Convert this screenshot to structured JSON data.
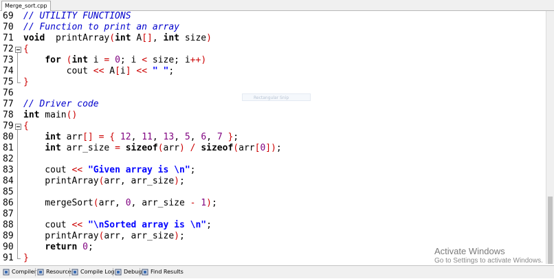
{
  "tab": {
    "filename": "Merge_sort.cpp"
  },
  "code": {
    "lines": [
      {
        "n": "69",
        "parts": [
          [
            "cm",
            "// UTILITY FUNCTIONS"
          ]
        ]
      },
      {
        "n": "70",
        "parts": [
          [
            "cm",
            "// Function to print an array"
          ]
        ]
      },
      {
        "n": "71",
        "parts": [
          [
            "kw",
            "void"
          ],
          [
            "",
            "  printArray"
          ],
          [
            "br",
            "("
          ],
          [
            "kw",
            "int"
          ],
          [
            "",
            " A"
          ],
          [
            "br",
            "[]"
          ],
          [
            "",
            ", "
          ],
          [
            "kw",
            "int"
          ],
          [
            "",
            " size"
          ],
          [
            "br",
            ")"
          ]
        ]
      },
      {
        "n": "72",
        "fold": true,
        "parts": [
          [
            "br",
            "{"
          ]
        ]
      },
      {
        "n": "73",
        "parts": [
          [
            "",
            "    "
          ],
          [
            "kw",
            "for"
          ],
          [
            "",
            " "
          ],
          [
            "br",
            "("
          ],
          [
            "kw",
            "int"
          ],
          [
            "",
            " i "
          ],
          [
            "op",
            "="
          ],
          [
            "",
            " "
          ],
          [
            "num",
            "0"
          ],
          [
            "",
            "; i "
          ],
          [
            "op",
            "<"
          ],
          [
            "",
            " size; i"
          ],
          [
            "op",
            "++"
          ],
          [
            "br",
            ")"
          ]
        ]
      },
      {
        "n": "74",
        "parts": [
          [
            "",
            "        cout "
          ],
          [
            "op",
            "<<"
          ],
          [
            "",
            " A"
          ],
          [
            "br",
            "["
          ],
          [
            "",
            "i"
          ],
          [
            "br",
            "]"
          ],
          [
            "",
            " "
          ],
          [
            "op",
            "<<"
          ],
          [
            "",
            " "
          ],
          [
            "str",
            "\" \""
          ],
          [
            "",
            ";"
          ]
        ]
      },
      {
        "n": "75",
        "foldEnd": true,
        "parts": [
          [
            "br",
            "}"
          ]
        ]
      },
      {
        "n": "76",
        "parts": []
      },
      {
        "n": "77",
        "parts": [
          [
            "cm",
            "// Driver code"
          ]
        ]
      },
      {
        "n": "78",
        "parts": [
          [
            "kw",
            "int"
          ],
          [
            "",
            " main"
          ],
          [
            "br",
            "()"
          ]
        ]
      },
      {
        "n": "79",
        "fold": true,
        "parts": [
          [
            "br",
            "{"
          ]
        ]
      },
      {
        "n": "80",
        "parts": [
          [
            "",
            "    "
          ],
          [
            "kw",
            "int"
          ],
          [
            "",
            " arr"
          ],
          [
            "br",
            "[]"
          ],
          [
            "",
            " "
          ],
          [
            "op",
            "="
          ],
          [
            "",
            " "
          ],
          [
            "br",
            "{"
          ],
          [
            "",
            " "
          ],
          [
            "num",
            "12"
          ],
          [
            "",
            ", "
          ],
          [
            "num",
            "11"
          ],
          [
            "",
            ", "
          ],
          [
            "num",
            "13"
          ],
          [
            "",
            ", "
          ],
          [
            "num",
            "5"
          ],
          [
            "",
            ", "
          ],
          [
            "num",
            "6"
          ],
          [
            "",
            ", "
          ],
          [
            "num",
            "7"
          ],
          [
            "",
            " "
          ],
          [
            "br",
            "}"
          ],
          [
            "",
            ";"
          ]
        ]
      },
      {
        "n": "81",
        "parts": [
          [
            "",
            "    "
          ],
          [
            "kw",
            "int"
          ],
          [
            "",
            " arr_size "
          ],
          [
            "op",
            "="
          ],
          [
            "",
            " "
          ],
          [
            "kw",
            "sizeof"
          ],
          [
            "br",
            "("
          ],
          [
            "",
            "arr"
          ],
          [
            "br",
            ")"
          ],
          [
            "",
            " "
          ],
          [
            "op",
            "/"
          ],
          [
            "",
            " "
          ],
          [
            "kw",
            "sizeof"
          ],
          [
            "br",
            "("
          ],
          [
            "",
            "arr"
          ],
          [
            "br",
            "["
          ],
          [
            "num",
            "0"
          ],
          [
            "br",
            "])"
          ],
          [
            "",
            ";"
          ]
        ]
      },
      {
        "n": "82",
        "parts": []
      },
      {
        "n": "83",
        "parts": [
          [
            "",
            "    cout "
          ],
          [
            "op",
            "<<"
          ],
          [
            "",
            " "
          ],
          [
            "str",
            "\"Given array is \\n\""
          ],
          [
            "",
            ";"
          ]
        ]
      },
      {
        "n": "84",
        "parts": [
          [
            "",
            "    printArray"
          ],
          [
            "br",
            "("
          ],
          [
            "",
            "arr, arr_size"
          ],
          [
            "br",
            ")"
          ],
          [
            "",
            ";"
          ]
        ]
      },
      {
        "n": "85",
        "parts": []
      },
      {
        "n": "86",
        "parts": [
          [
            "",
            "    mergeSort"
          ],
          [
            "br",
            "("
          ],
          [
            "",
            "arr, "
          ],
          [
            "num",
            "0"
          ],
          [
            "",
            ", arr_size "
          ],
          [
            "op",
            "-"
          ],
          [
            "",
            " "
          ],
          [
            "num",
            "1"
          ],
          [
            "br",
            ")"
          ],
          [
            "",
            ";"
          ]
        ]
      },
      {
        "n": "87",
        "parts": []
      },
      {
        "n": "88",
        "parts": [
          [
            "",
            "    cout "
          ],
          [
            "op",
            "<<"
          ],
          [
            "",
            " "
          ],
          [
            "str",
            "\"\\nSorted array is \\n\""
          ],
          [
            "",
            ";"
          ]
        ]
      },
      {
        "n": "89",
        "parts": [
          [
            "",
            "    printArray"
          ],
          [
            "br",
            "("
          ],
          [
            "",
            "arr, arr_size"
          ],
          [
            "br",
            ")"
          ],
          [
            "",
            ";"
          ]
        ]
      },
      {
        "n": "90",
        "parts": [
          [
            "",
            "    "
          ],
          [
            "kw",
            "return"
          ],
          [
            "",
            " "
          ],
          [
            "num",
            "0"
          ],
          [
            "",
            ";"
          ]
        ]
      },
      {
        "n": "91",
        "foldEnd": true,
        "parts": [
          [
            "br",
            "}"
          ]
        ]
      }
    ]
  },
  "tooltip": {
    "text": "Rectangular Snip"
  },
  "watermark": {
    "title": "Activate Windows",
    "subtitle": "Go to Settings to activate Windows."
  },
  "bottom_tabs": [
    {
      "label": "Compiler",
      "icon": "compiler-icon"
    },
    {
      "label": "Resources",
      "icon": "resources-icon"
    },
    {
      "label": "Compile Log",
      "icon": "compile-log-icon"
    },
    {
      "label": "Debug",
      "icon": "debug-icon"
    },
    {
      "label": "Find Results",
      "icon": "find-results-icon"
    }
  ],
  "colors": {
    "comment": "#0000cc",
    "bracket": "#cc0000",
    "number": "#7f007f",
    "string": "#0000ff"
  }
}
